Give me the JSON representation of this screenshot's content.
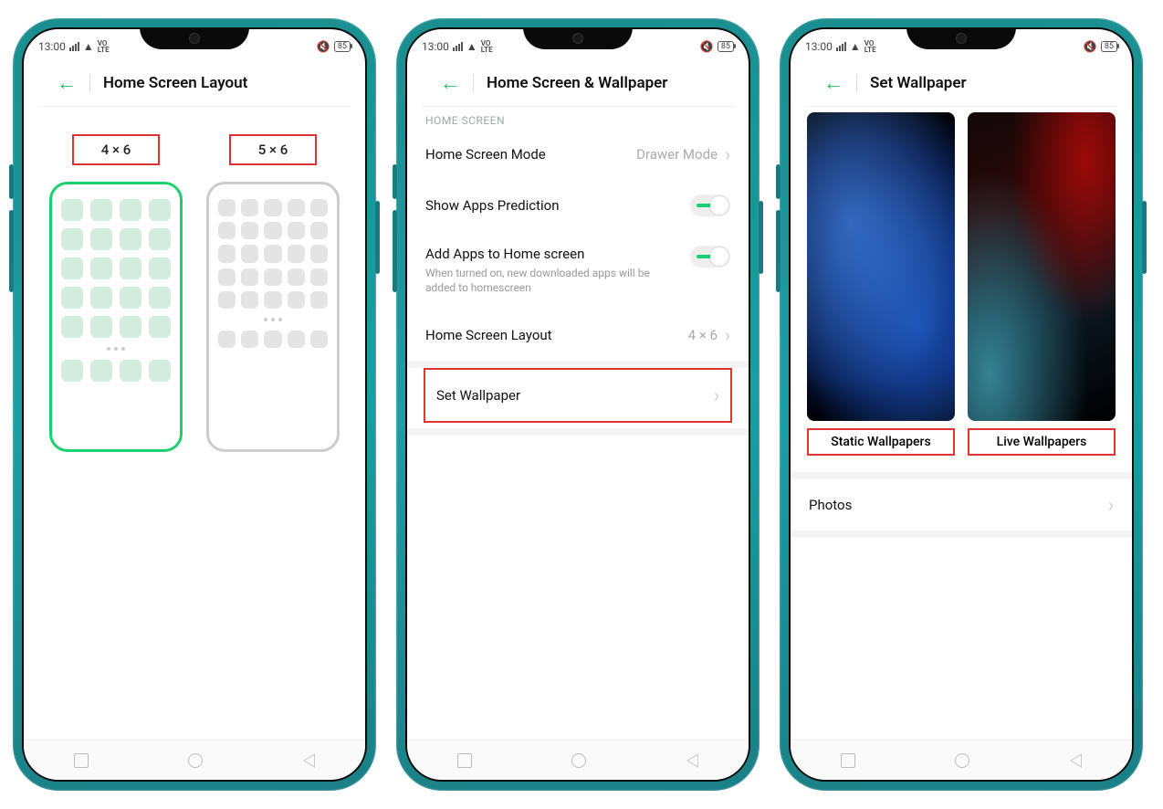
{
  "status": {
    "time": "13:00",
    "volte_top": "VO",
    "volte_bot": "LTE",
    "battery": "85"
  },
  "screen1": {
    "title": "Home Screen Layout",
    "options": [
      {
        "label": "4 × 6",
        "cols": 4,
        "selected": true
      },
      {
        "label": "5 × 6",
        "cols": 5,
        "selected": false
      }
    ]
  },
  "screen2": {
    "title": "Home Screen & Wallpaper",
    "section_head": "HOME SCREEN",
    "rows": {
      "mode": {
        "label": "Home Screen Mode",
        "value": "Drawer Mode"
      },
      "predict": {
        "label": "Show Apps Prediction",
        "on": true
      },
      "addapps": {
        "label": "Add Apps to Home screen",
        "sub": "When turned on, new downloaded apps will be added to homescreen",
        "on": true
      },
      "layout": {
        "label": "Home Screen Layout",
        "value": "4 × 6"
      },
      "wallpaper": {
        "label": "Set Wallpaper"
      }
    }
  },
  "screen3": {
    "title": "Set Wallpaper",
    "cards": {
      "static": "Static Wallpapers",
      "live": "Live Wallpapers"
    },
    "photos": "Photos"
  }
}
